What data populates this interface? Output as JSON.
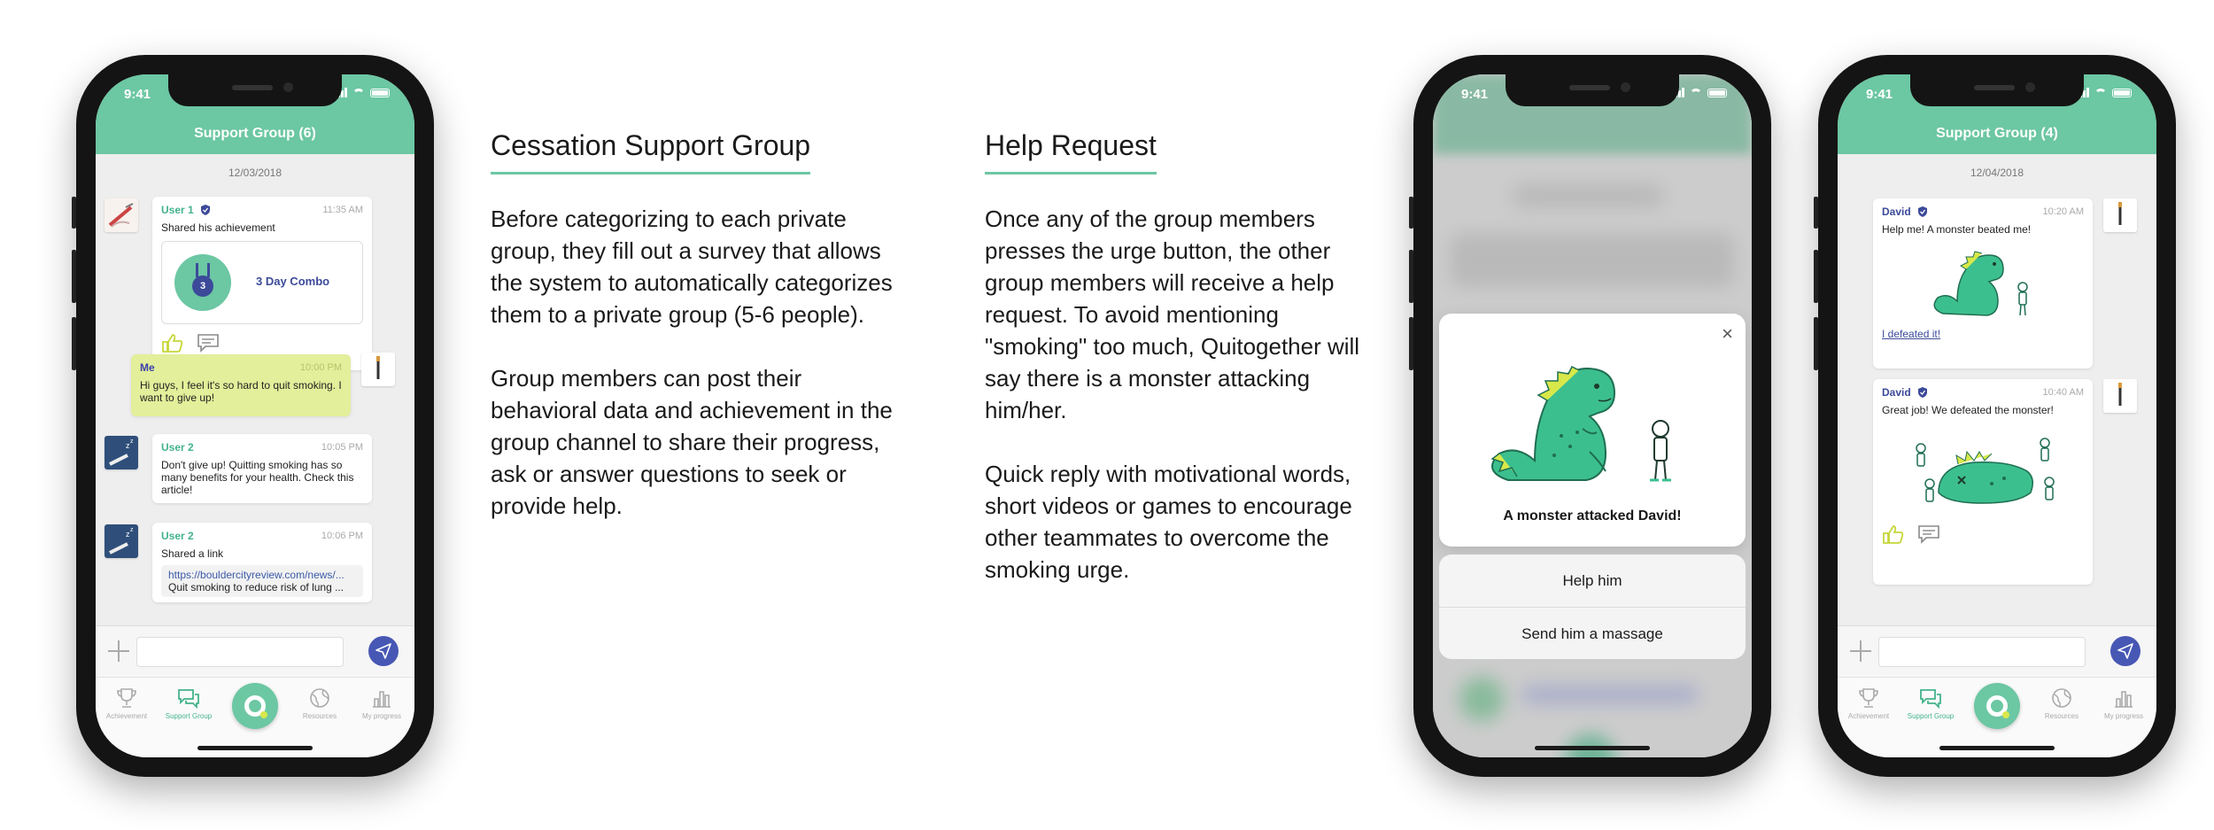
{
  "phone1": {
    "status_time": "9:41",
    "header_title": "Support Group (6)",
    "date": "12/03/2018",
    "messages": [
      {
        "name": "User 1",
        "time": "11:35 AM",
        "text": "Shared his achievement",
        "achievement": "3 Day Combo",
        "medal_number": "3"
      },
      {
        "name": "Me",
        "time": "10:00 PM",
        "text": "Hi guys, I feel it's so hard to quit smoking. I want to give up!"
      },
      {
        "name": "User 2",
        "time": "10:05 PM",
        "text": "Don't give up! Quitting smoking has so many benefits for your health. Check this article!"
      },
      {
        "name": "User 2",
        "time": "10:06 PM",
        "text": "Shared a link",
        "link_url": "https://bouldercityreview.com/news/...",
        "link_title": "Quit smoking to reduce risk of lung ..."
      }
    ],
    "tabs": [
      "Achievement",
      "Support Group",
      "",
      "Resources",
      "My progress"
    ]
  },
  "section1": {
    "title": "Cessation Support Group",
    "p1": "Before categorizing to each private group, they fill out a survey that allows the system to automatically categorizes them to a private group (5-6 people).",
    "p2": "Group members can post their behavioral data and achievement in the group channel to share their progress, ask or answer questions to seek or provide help."
  },
  "section2": {
    "title": "Help Request",
    "p1": "Once any of the group members presses the urge button, the other group members will receive a help request. To avoid mentioning \"smoking\" too much, Quitogether will say there is a monster attacking him/her.",
    "p2": "Quick reply with motivational words, short videos or games to encourage other teammates to overcome the smoking urge."
  },
  "phone2": {
    "status_time": "9:41",
    "modal_caption": "A monster attacked David!",
    "close_glyph": "×",
    "options": [
      "Help him",
      "Send him a massage"
    ]
  },
  "phone3": {
    "status_time": "9:41",
    "header_title": "Support Group (4)",
    "date": "12/04/2018",
    "messages": [
      {
        "name": "David",
        "time": "10:20 AM",
        "text": "Help me! A monster beated me!",
        "link": "I defeated it!"
      },
      {
        "name": "David",
        "time": "10:40 AM",
        "text": "Great job! We defeated the monster!"
      }
    ],
    "tabs": [
      "Achievement",
      "Support Group",
      "",
      "Resources",
      "My progress"
    ]
  },
  "colors": {
    "accent": "#6cc7a3",
    "brand_dark": "#3c4a9a",
    "me_bubble": "#e3ef9a",
    "monster": "#3cbf8e"
  },
  "icons": [
    "shield-badge-icon",
    "thumbs-up-icon",
    "comment-icon",
    "plus-icon",
    "send-icon",
    "trophy-icon",
    "chat-icon",
    "urge-button-icon",
    "globe-icon",
    "bar-chart-icon",
    "close-icon"
  ]
}
